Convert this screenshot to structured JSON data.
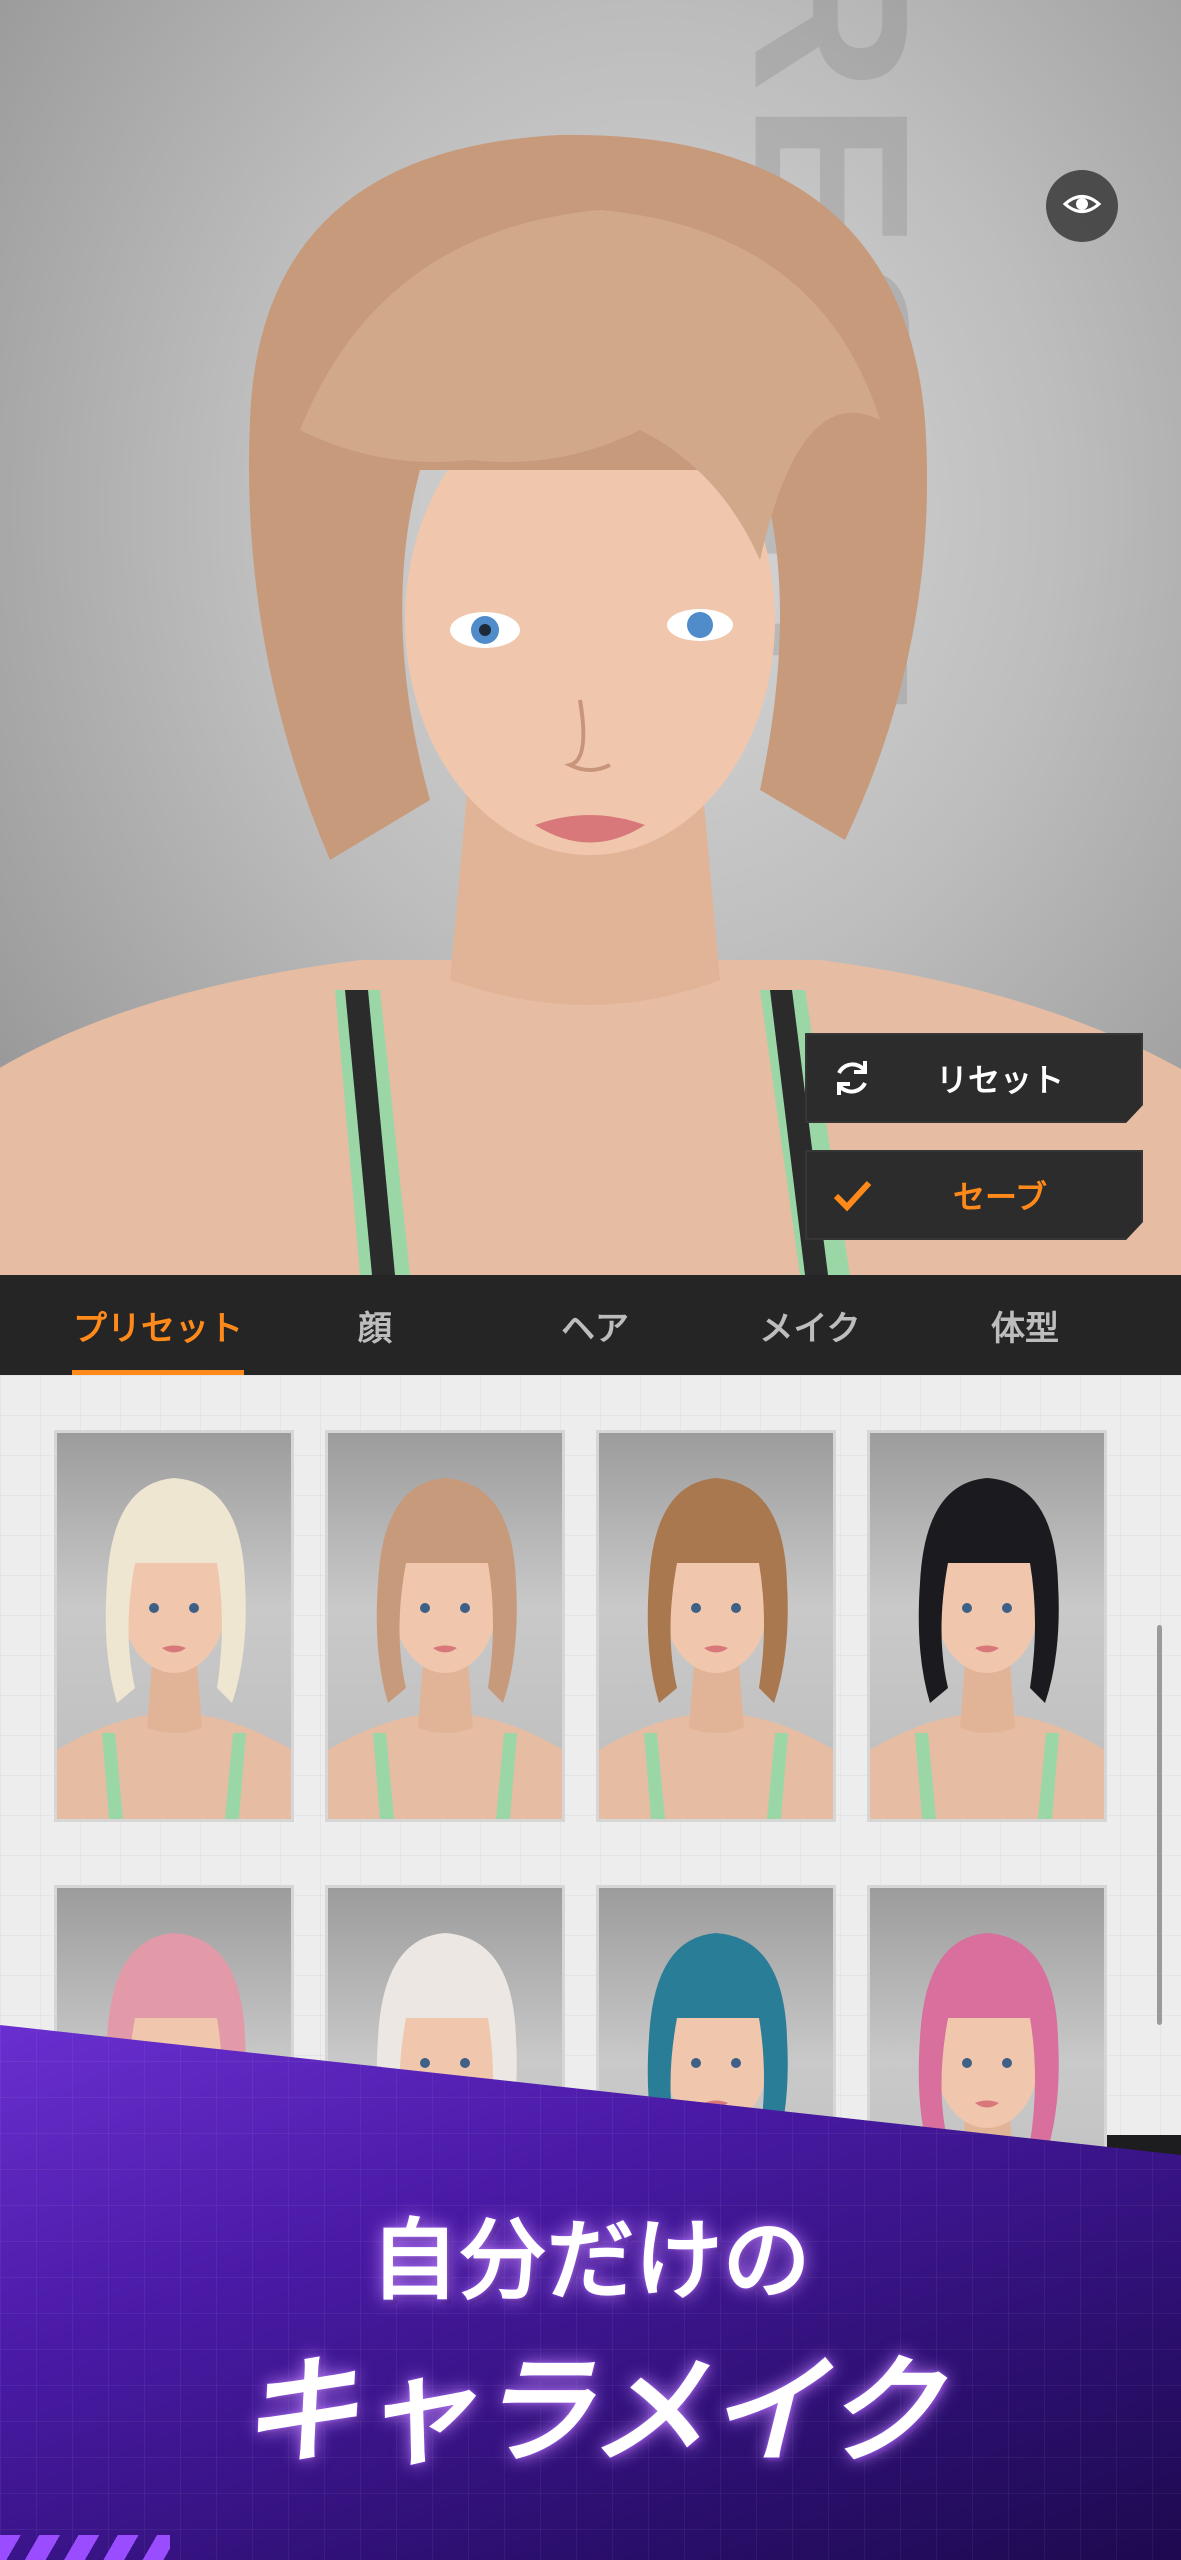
{
  "viewport": {
    "watermark_text": "PRESET",
    "actions": {
      "reset_label": "リセット",
      "save_label": "セーブ"
    },
    "icons": {
      "visibility": "eye-icon",
      "reset": "refresh-icon",
      "save": "check-icon"
    }
  },
  "tabs": [
    {
      "label": "プリセット",
      "active": true
    },
    {
      "label": "顔",
      "active": false
    },
    {
      "label": "ヘア",
      "active": false
    },
    {
      "label": "メイク",
      "active": false
    },
    {
      "label": "体型",
      "active": false
    }
  ],
  "presets": [
    {
      "hair": "#efe6d2"
    },
    {
      "hair": "#c79a7c"
    },
    {
      "hair": "#a9784f"
    },
    {
      "hair": "#1b1b1f"
    },
    {
      "hair": "#e39aa8"
    },
    {
      "hair": "#ece7e2"
    },
    {
      "hair": "#2a7d96"
    },
    {
      "hair": "#d86f9c"
    }
  ],
  "banner": {
    "line1": "自分だけの",
    "line2": "キャラメイク"
  },
  "colors": {
    "accent": "#ff8a1a",
    "tabbar_bg": "#252525",
    "banner_purple": "#4a1aa6"
  }
}
